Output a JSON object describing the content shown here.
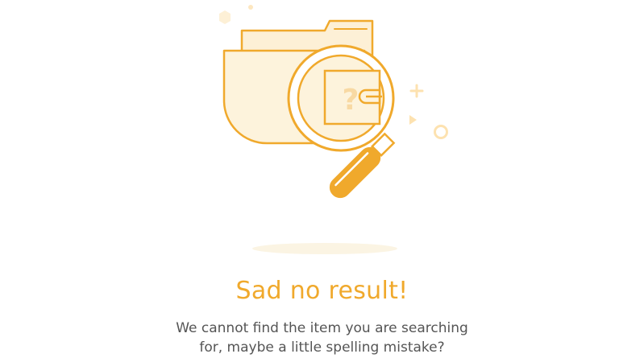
{
  "empty_state": {
    "title": "Sad no result!",
    "message_line1": "We cannot find the item you are searching",
    "message_line2": "for, maybe a little spelling mistake?",
    "illustration_glyph": "?",
    "icons": [
      "folder-icon",
      "magnifier-icon",
      "question-mark-icon",
      "sparkle-decoration"
    ]
  },
  "colors": {
    "accent": "#f0a92c",
    "accent_light": "#fdf3dc",
    "text": "#555555",
    "background": "#ffffff"
  }
}
